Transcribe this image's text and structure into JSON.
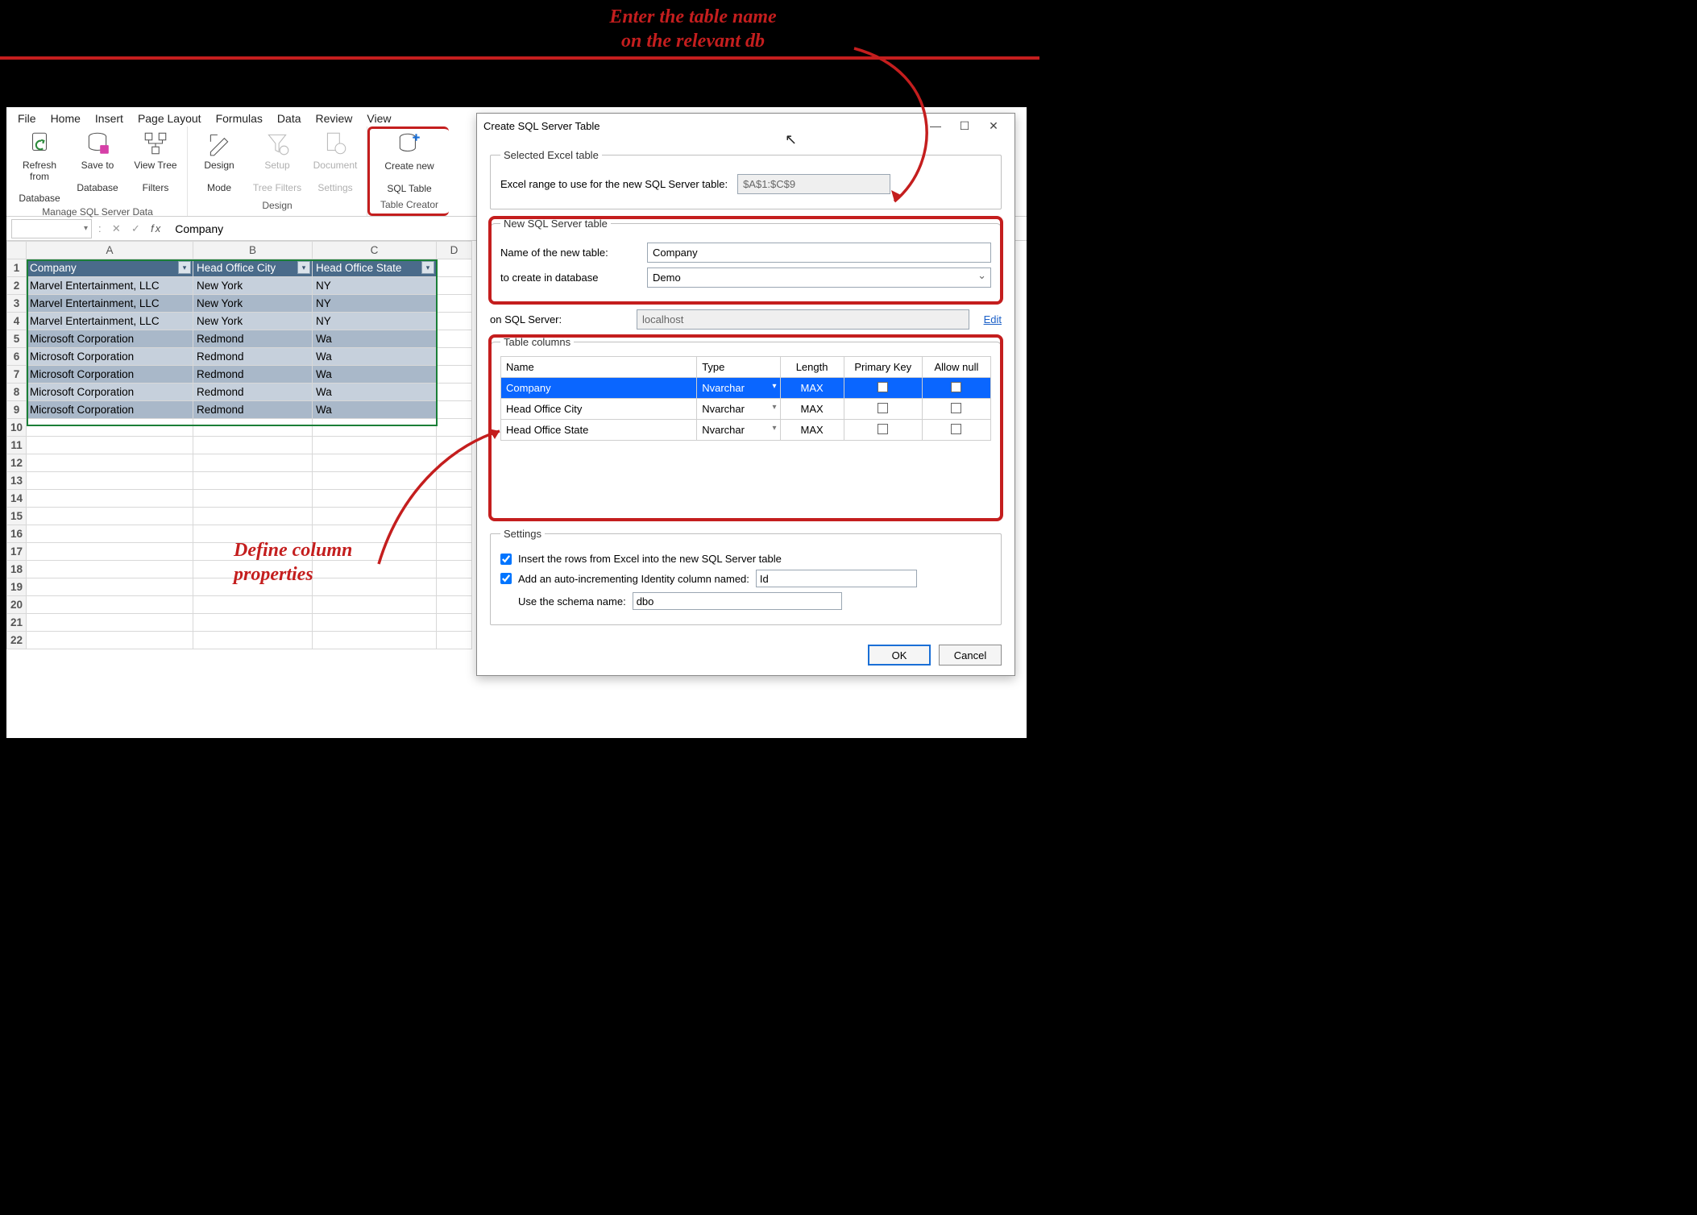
{
  "annotations": {
    "a1_line1": "Enter the table name",
    "a1_line2": "on the relevant db",
    "a2_line1": "Define column",
    "a2_line2": "properties"
  },
  "menu": {
    "file": "File",
    "home": "Home",
    "insert": "Insert",
    "page_layout": "Page Layout",
    "formulas": "Formulas",
    "data": "Data",
    "review": "Review",
    "view": "View"
  },
  "ribbon": {
    "manage": {
      "label": "Manage SQL Server Data",
      "refresh_l1": "Refresh from",
      "refresh_l2": "Database",
      "save_l1": "Save to",
      "save_l2": "Database",
      "viewtree_l1": "View Tree",
      "viewtree_l2": "Filters"
    },
    "design": {
      "label": "Design",
      "designmode_l1": "Design",
      "designmode_l2": "Mode",
      "setup_l1": "Setup",
      "setup_l2": "Tree Filters",
      "doc_l1": "Document",
      "doc_l2": "Settings"
    },
    "creator": {
      "label": "Table Creator",
      "create_l1": "Create new",
      "create_l2": "SQL Table"
    }
  },
  "formula_bar": {
    "value": "Company"
  },
  "grid": {
    "cols": [
      "A",
      "B",
      "C",
      "D"
    ],
    "row_labels": [
      "1",
      "2",
      "3",
      "4",
      "5",
      "6",
      "7",
      "8",
      "9",
      "10",
      "11",
      "12",
      "13",
      "14",
      "15",
      "16",
      "17",
      "18",
      "19",
      "20",
      "21",
      "22"
    ],
    "header": {
      "c1": "Company",
      "c2": "Head Office City",
      "c3": "Head Office State"
    },
    "rows": [
      {
        "c1": "Marvel Entertainment, LLC",
        "c2": "New York",
        "c3": "NY"
      },
      {
        "c1": "Marvel Entertainment, LLC",
        "c2": "New York",
        "c3": "NY"
      },
      {
        "c1": "Marvel Entertainment, LLC",
        "c2": "New York",
        "c3": "NY"
      },
      {
        "c1": "Microsoft Corporation",
        "c2": "Redmond",
        "c3": "Wa"
      },
      {
        "c1": "Microsoft Corporation",
        "c2": "Redmond",
        "c3": "Wa"
      },
      {
        "c1": "Microsoft Corporation",
        "c2": "Redmond",
        "c3": "Wa"
      },
      {
        "c1": "Microsoft Corporation",
        "c2": "Redmond",
        "c3": "Wa"
      },
      {
        "c1": "Microsoft Corporation",
        "c2": "Redmond",
        "c3": "Wa"
      }
    ]
  },
  "dialog": {
    "title": "Create SQL Server Table",
    "selected_legend": "Selected Excel table",
    "range_label": "Excel range to use for the new SQL Server table:",
    "range_value": "$A$1:$C$9",
    "new_legend": "New SQL Server table",
    "name_label": "Name of the new table:",
    "name_value": "Company",
    "db_label": "to create in database",
    "db_value": "Demo",
    "server_label": "on SQL Server:",
    "server_value": "localhost",
    "edit": "Edit",
    "cols_legend": "Table columns",
    "col_head": {
      "name": "Name",
      "type": "Type",
      "length": "Length",
      "pk": "Primary Key",
      "allownull": "Allow null"
    },
    "col_rows": [
      {
        "name": "Company",
        "type": "Nvarchar",
        "length": "MAX"
      },
      {
        "name": "Head Office City",
        "type": "Nvarchar",
        "length": "MAX"
      },
      {
        "name": "Head Office State",
        "type": "Nvarchar",
        "length": "MAX"
      }
    ],
    "settings_legend": "Settings",
    "insert_rows_label": "Insert the rows from Excel into the new SQL Server table",
    "identity_label": "Add an auto-incrementing Identity column named:",
    "identity_value": "Id",
    "schema_label": "Use the schema name:",
    "schema_value": "dbo",
    "ok": "OK",
    "cancel": "Cancel"
  }
}
